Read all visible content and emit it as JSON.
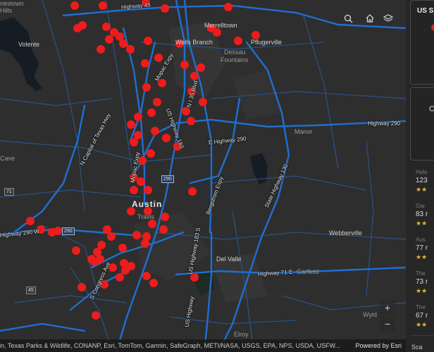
{
  "map": {
    "labels": {
      "austin": "Austin",
      "travis": "Travis",
      "volente": "Volente",
      "merrelltown": "Merrelltown",
      "wells_branch": "Wells Branch",
      "pflugerville": "Pflugerville",
      "dessau": "Dessau",
      "fountains": "Fountains",
      "manor": "Manor",
      "webberville": "Webberville",
      "del_valle": "Del Valle",
      "garfield": "Garfield",
      "elroy": "Elroy",
      "wyld": "Wyld",
      "cave": "Cave",
      "hills": "Hills",
      "top_left": "nestown"
    },
    "roads": {
      "hwy45": "Highway 45",
      "hwy290_east": "Highway 290",
      "e_hwy290": "E Highway 290",
      "n_capital_texas": "N Capital of Texas Hwy",
      "mopac_expy_north": "Mopac Expy",
      "mopac_expy_mid": "Mopac Expy",
      "us_hwy_183": "US Highway 183",
      "n_lamar": "N I 35 Blvd",
      "bergstrom": "Bergstrom Expy",
      "state_hwy_130": "State Highway 130",
      "hwy71": "Highway 71 E",
      "s_congress": "S Congress Ave",
      "us_hwy_183_s": "US Highway 183 S",
      "hwy290_w": "Highway 290 W",
      "us_hwy_south": "US Highway",
      "state_south": "State Highway 130"
    },
    "shields": {
      "s290a": "290",
      "s290b": "290",
      "s71": "71",
      "s45": "45"
    },
    "tools": {
      "search": "search-icon",
      "home": "home-icon",
      "layers": "layers-icon"
    },
    "zoom": {
      "in": "+",
      "out": "−"
    },
    "attribution": "stin, Texas Parks & Wildlife, CONANP, Esri, TomTom, Garmin, SafeGraph, METI/NASA, USGS, EPA, NPS, USDA, USFW...",
    "powered_by": "Powered by Esri",
    "colors": {
      "highway": "#1f6fd1",
      "road": "#2a5288",
      "point": "#ee1c1c",
      "water": "#151c24",
      "land": "#2e2e2e"
    }
  },
  "panel": {
    "legend_title": "US S",
    "card2_letter": "C",
    "items": [
      {
        "name": "Halo",
        "count": "123",
        "stars": "★★"
      },
      {
        "name": "Gar",
        "count": "83 r",
        "stars": "★★"
      },
      {
        "name": "Aus",
        "count": "77 r",
        "stars": "★★"
      },
      {
        "name": "The",
        "count": "73 r",
        "stars": "★★"
      },
      {
        "name": "The",
        "count": "67 r",
        "stars": "★★"
      }
    ],
    "footer": "Sca"
  }
}
